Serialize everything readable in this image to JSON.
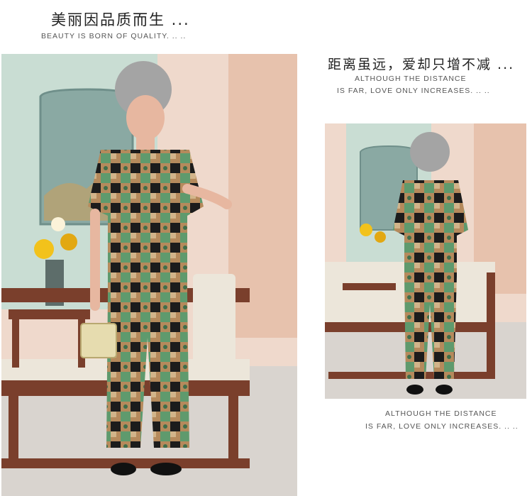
{
  "header": {
    "headline_cn": "美丽因品质而生 ...",
    "subtitle_en": "BEAUTY IS BORN OF QUALITY. .. .."
  },
  "right_caption": {
    "headline_cn": "距离虽远，爱却只增不减 ...",
    "line1_en": "ALTHOUGH THE DISTANCE",
    "line2_en": "IS FAR, LOVE ONLY INCREASES. .. .."
  },
  "bottom_caption": {
    "line1_en": "ALTHOUGH THE DISTANCE",
    "line2_en": "IS FAR, LOVE ONLY INCREASES. .. .."
  },
  "colors": {
    "wall": "#e9c9b9",
    "wall_panel": "#a9c9bd",
    "sofa_wood": "#7a3f2c",
    "cushion": "#ece6da",
    "outfit_green": "#5f9a6d",
    "outfit_tan": "#b58a5c",
    "outfit_black": "#1c1c1c"
  }
}
